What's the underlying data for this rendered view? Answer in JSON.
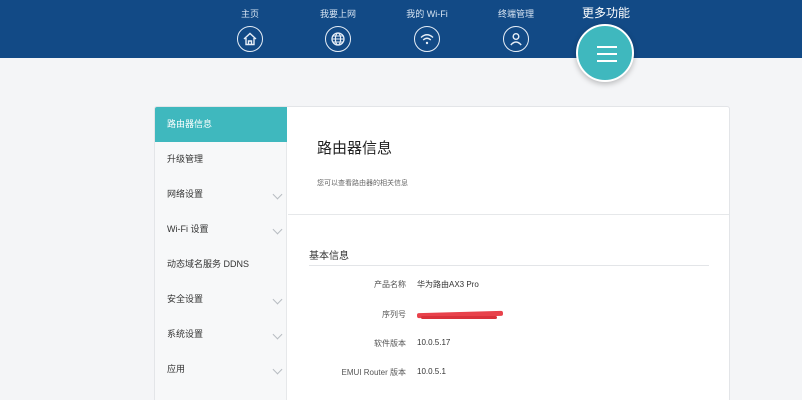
{
  "header": {
    "nav": [
      {
        "label": "主页",
        "icon": "home-icon"
      },
      {
        "label": "我要上网",
        "icon": "globe-icon"
      },
      {
        "label": "我的 Wi-Fi",
        "icon": "wifi-icon"
      },
      {
        "label": "终端管理",
        "icon": "user-icon"
      }
    ],
    "more": {
      "label": "更多功能",
      "icon": "menu-icon"
    },
    "colors": {
      "bar": "#124a86",
      "accent": "#3fb8be"
    }
  },
  "sidebar": {
    "items": [
      {
        "label": "路由器信息",
        "active": true,
        "expandable": false
      },
      {
        "label": "升级管理",
        "active": false,
        "expandable": false
      },
      {
        "label": "网络设置",
        "active": false,
        "expandable": true
      },
      {
        "label": "Wi-Fi 设置",
        "active": false,
        "expandable": true
      },
      {
        "label": "动态域名服务 DDNS",
        "active": false,
        "expandable": false
      },
      {
        "label": "安全设置",
        "active": false,
        "expandable": true
      },
      {
        "label": "系统设置",
        "active": false,
        "expandable": true
      },
      {
        "label": "应用",
        "active": false,
        "expandable": true
      }
    ]
  },
  "main": {
    "title": "路由器信息",
    "subtitle": "您可以查看路由器的相关信息",
    "section_title": "基本信息",
    "rows": [
      {
        "label": "产品名称",
        "value": "华为路由AX3 Pro"
      },
      {
        "label": "序列号",
        "value": ""
      },
      {
        "label": "软件版本",
        "value": "10.0.5.17"
      },
      {
        "label": "EMUI Router 版本",
        "value": "10.0.5.1"
      }
    ]
  }
}
